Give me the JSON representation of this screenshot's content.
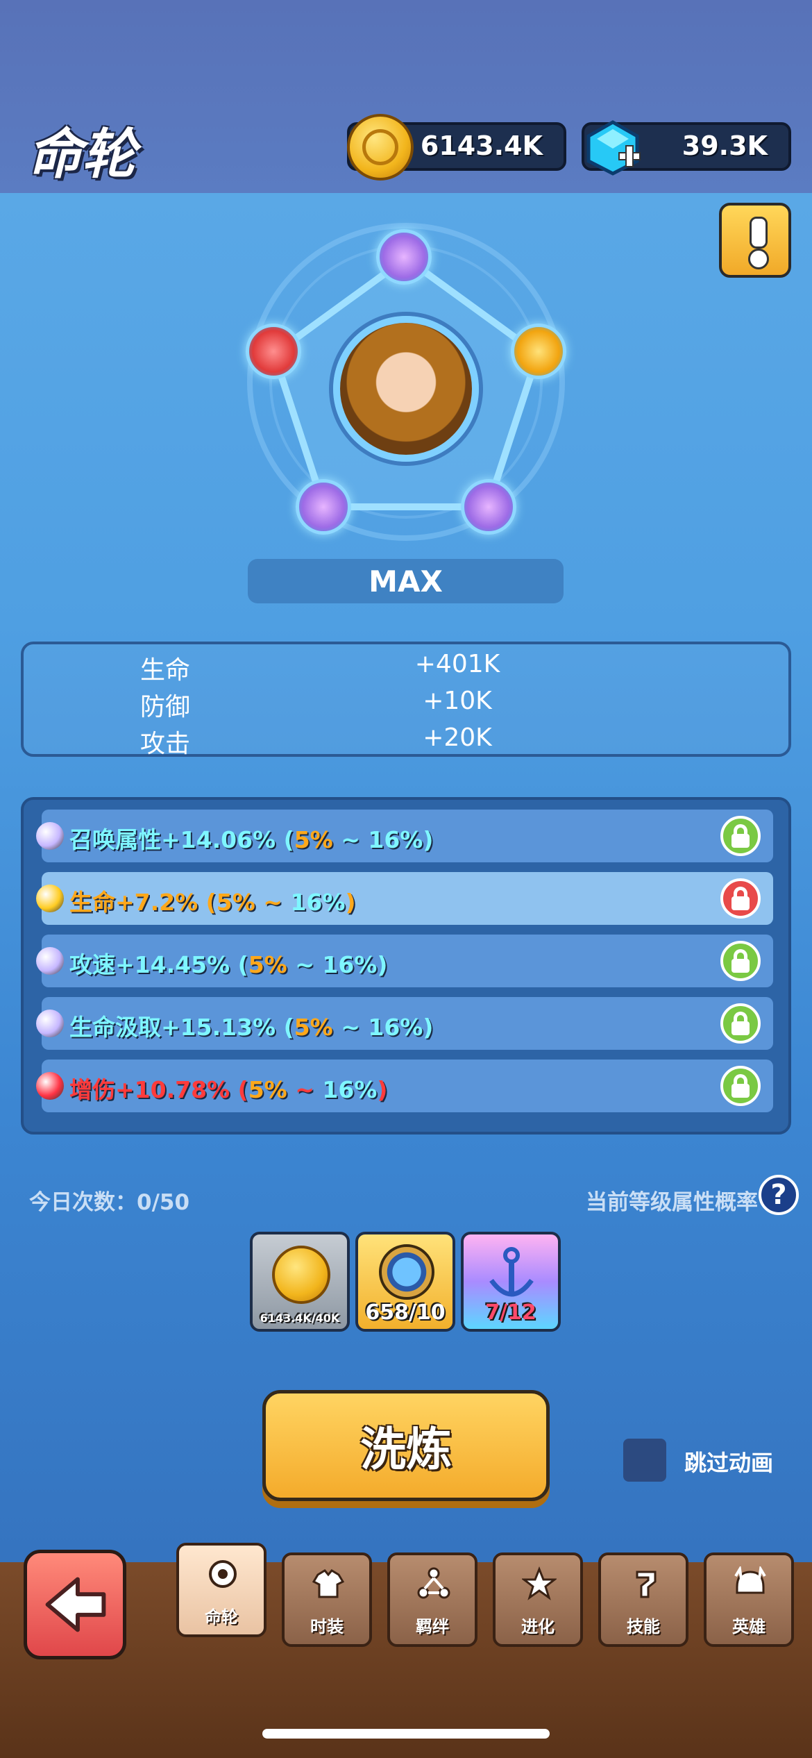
{
  "header": {
    "title": "命轮",
    "coins": "6143.4K",
    "gems": "39.3K"
  },
  "portrait": {
    "level": "MAX"
  },
  "stats": [
    {
      "label": "生命",
      "value": "+401K"
    },
    {
      "label": "防御",
      "value": "+10K"
    },
    {
      "label": "攻击",
      "value": "+20K"
    }
  ],
  "attributes": [
    {
      "name": "召唤属性",
      "value": "+14.06%",
      "min": "5%",
      "max": "16%",
      "gem_color": "#c6b7ff",
      "name_color": "#7ff6ff",
      "locked": false
    },
    {
      "name": "生命",
      "value": "+7.2%",
      "min": "5%",
      "max": "16%",
      "gem_color": "#ffcc22",
      "name_color": "#ffa81a",
      "locked": true
    },
    {
      "name": "攻速",
      "value": "+14.45%",
      "min": "5%",
      "max": "16%",
      "gem_color": "#c6b7ff",
      "name_color": "#7ff6ff",
      "locked": false
    },
    {
      "name": "生命汲取",
      "value": "+15.13%",
      "min": "5%",
      "max": "16%",
      "gem_color": "#c6b7ff",
      "name_color": "#7ff6ff",
      "locked": false
    },
    {
      "name": "增伤",
      "value": "+10.78%",
      "min": "5%",
      "max": "16%",
      "gem_color": "#ff3344",
      "name_color": "#ff3b3b",
      "locked": false
    }
  ],
  "daily_count": "今日次数：0/50",
  "probability_label": "当前等级属性概率",
  "help_label": "?",
  "costs": [
    {
      "icon": "coin-icon",
      "text": "6143.4K/40K"
    },
    {
      "icon": "compass-icon",
      "text": "658/10"
    },
    {
      "icon": "anchor-icon",
      "text": "7/12"
    }
  ],
  "refine_label": "洗炼",
  "skip_label": "跳过动画",
  "tabs": [
    {
      "label": "命轮",
      "icon": "wheel-icon",
      "active": true
    },
    {
      "label": "时装",
      "icon": "outfit-icon",
      "active": false
    },
    {
      "label": "羁绊",
      "icon": "bond-icon",
      "active": false
    },
    {
      "label": "进化",
      "icon": "evolve-icon",
      "active": false
    },
    {
      "label": "技能",
      "icon": "skill-icon",
      "active": false
    },
    {
      "label": "英雄",
      "icon": "hero-helmet-icon",
      "active": false
    }
  ],
  "colors": {
    "lock_green": "#7ac943",
    "lock_red": "#e84a4a",
    "min_orange": "#ffa81a",
    "max_cyan": "#7ff6ff"
  }
}
